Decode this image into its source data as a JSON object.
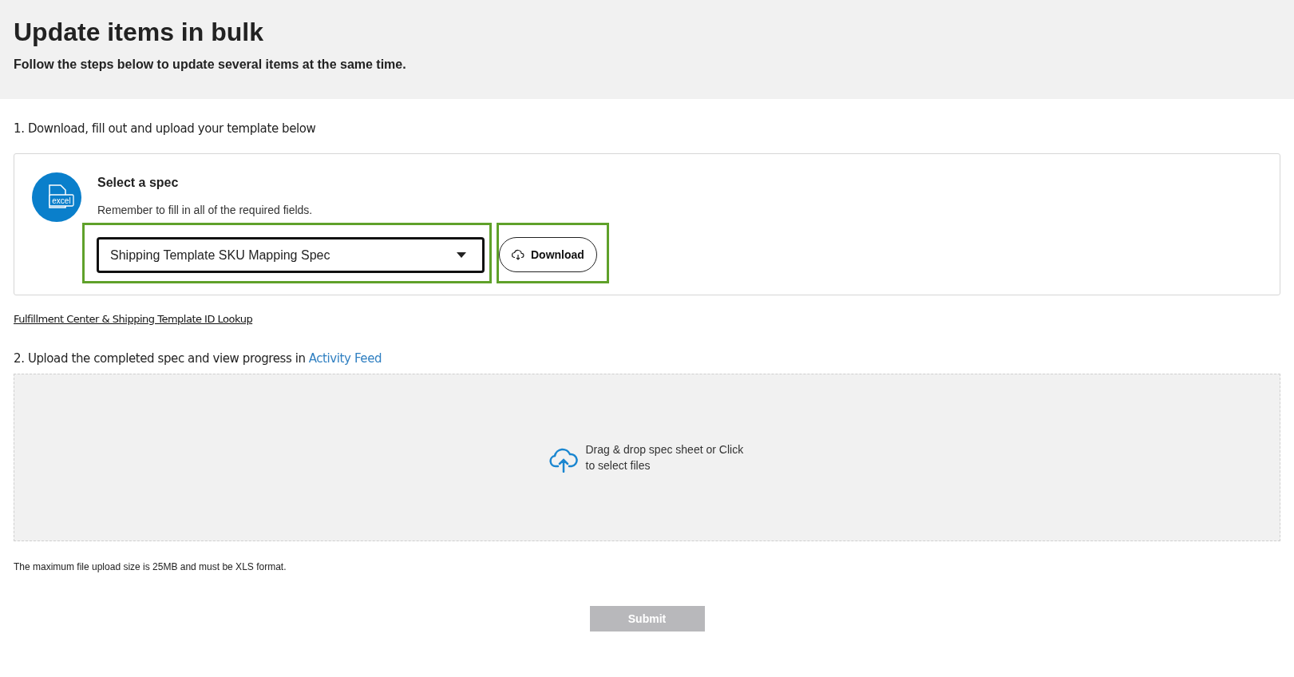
{
  "header": {
    "title": "Update items in bulk",
    "subtitle": "Follow the steps below to update several items at the same time."
  },
  "step1": {
    "heading": "1. Download, fill out and upload your template below",
    "card": {
      "title": "Select a spec",
      "hint": "Remember to fill in all of the required fields.",
      "icon_label": "excel",
      "select": {
        "value": "Shipping Template SKU Mapping Spec",
        "highlighted": true
      },
      "download": {
        "label": "Download",
        "highlighted": true
      }
    },
    "link": "Fulfillment Center & Shipping Template ID Lookup"
  },
  "step2": {
    "heading": "2. Upload the completed spec and view progress in ",
    "heading_link": "Activity Feed",
    "dropzone": {
      "text": "Drag & drop spec sheet or Click to select files"
    },
    "note": "The maximum file upload size is 25MB and must be XLS format."
  },
  "submit": {
    "label": "Submit",
    "disabled": true
  }
}
